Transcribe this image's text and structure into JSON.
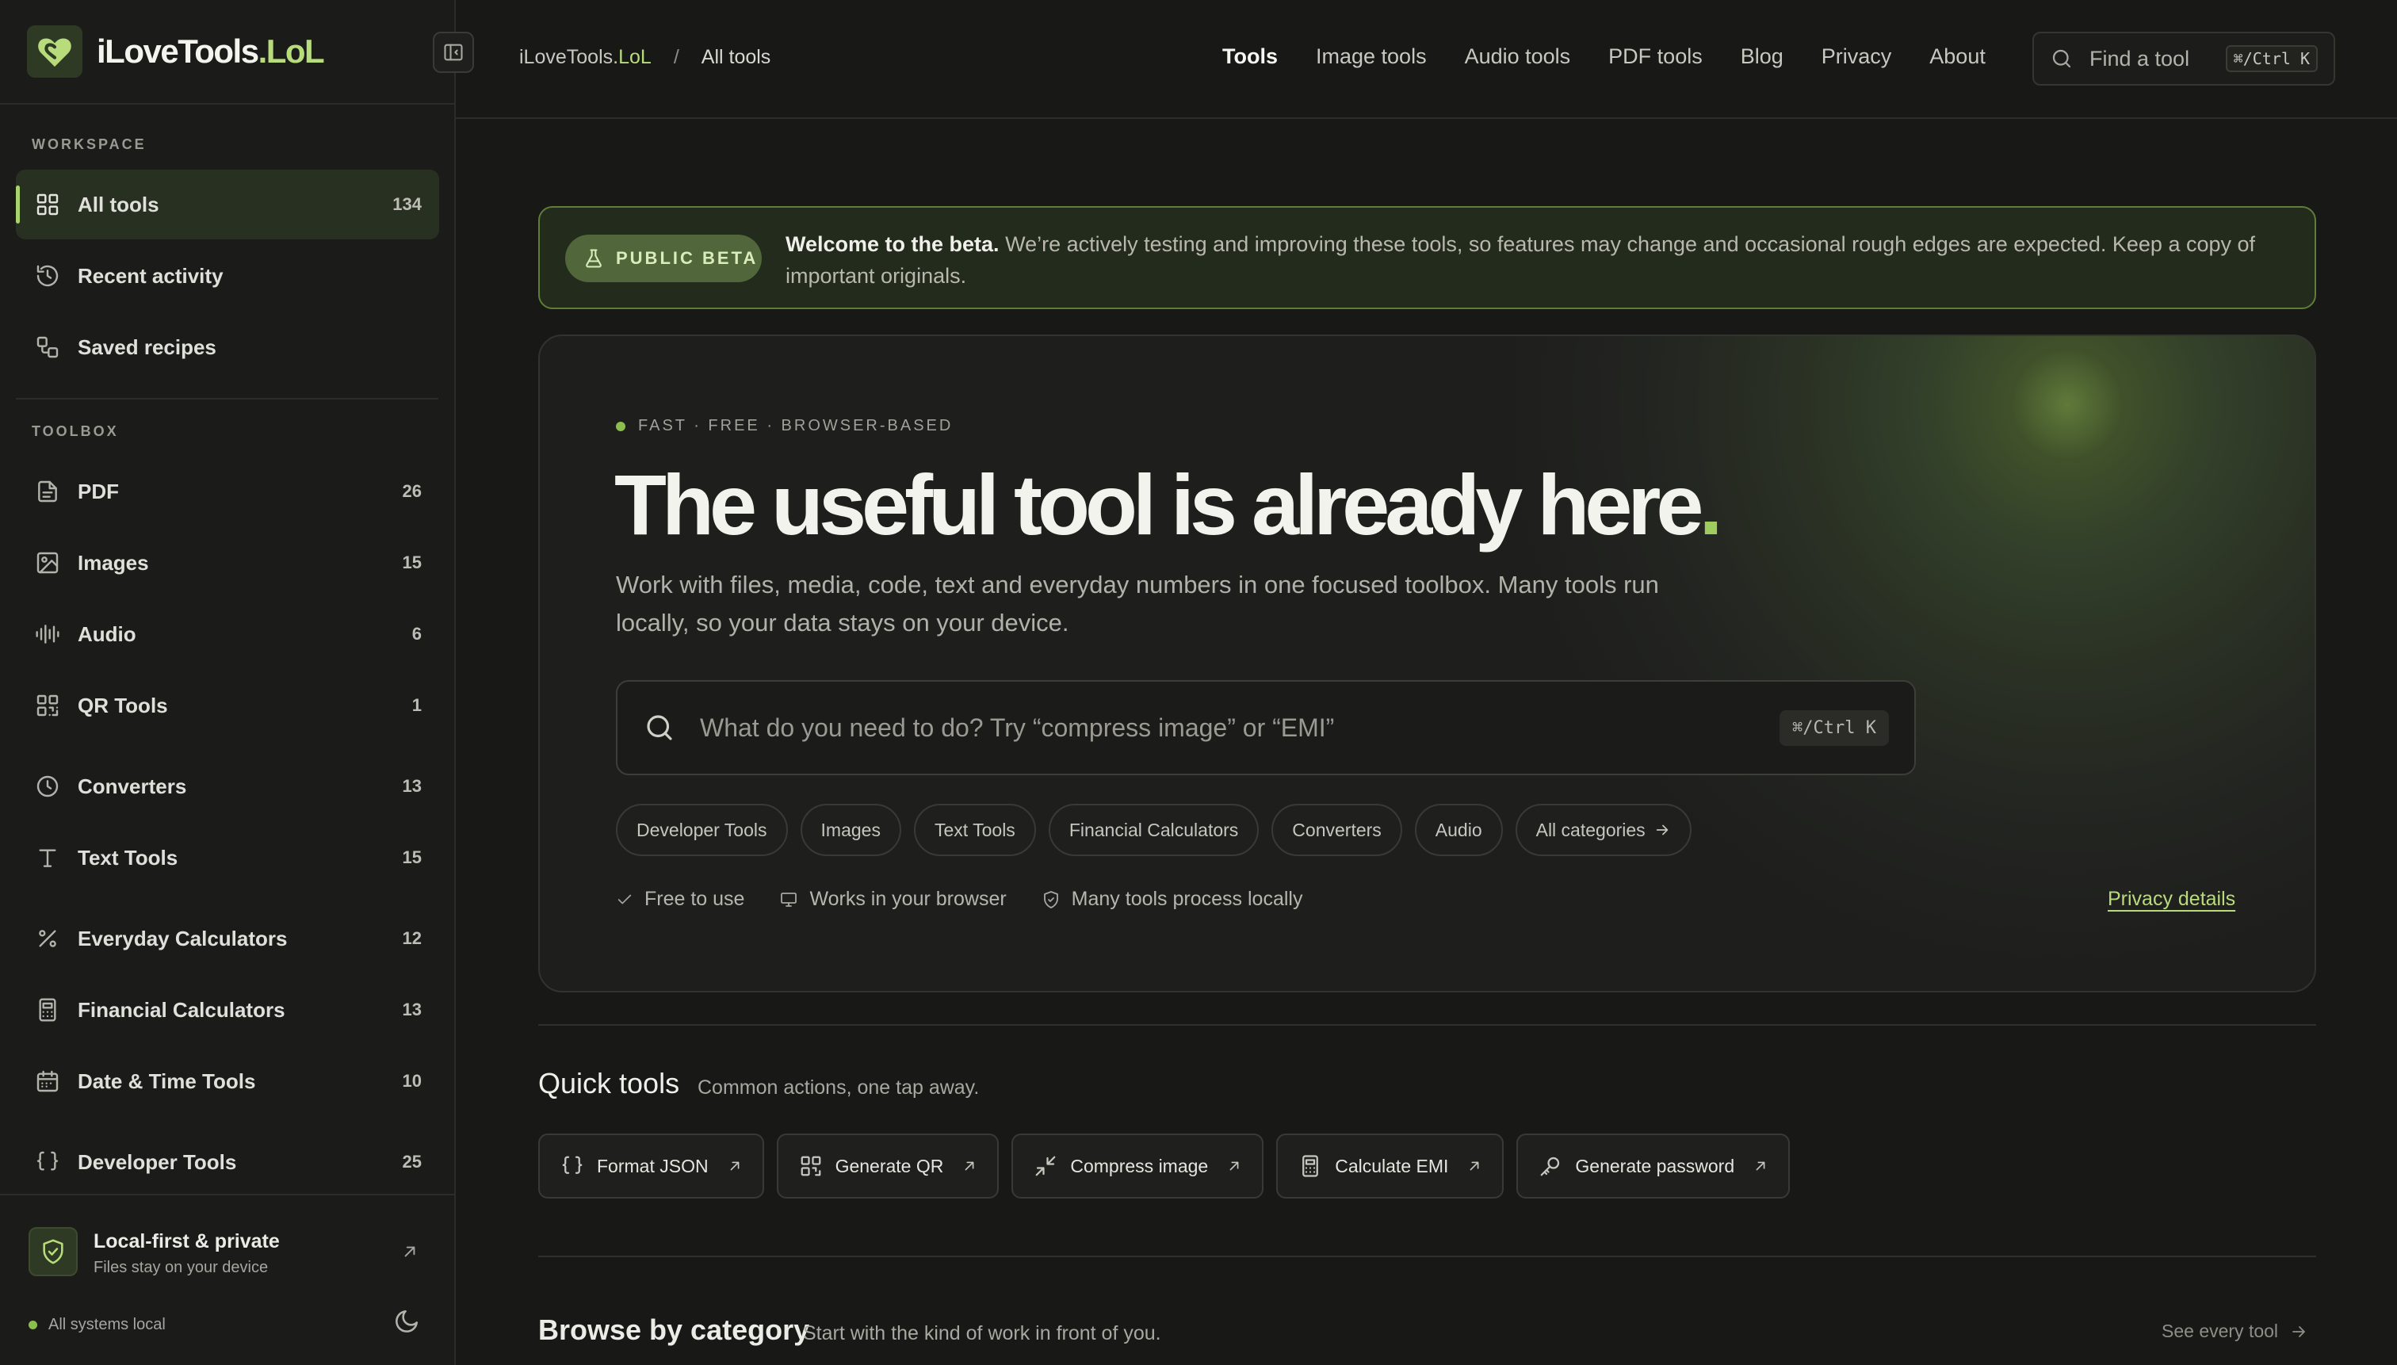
{
  "app": {
    "brand_main": "iLoveTools",
    "brand_accent": ".LoL",
    "accent_color": "#b8dc7c"
  },
  "sidebar": {
    "workspace_label": "WORKSPACE",
    "toolbox_label": "TOOLBOX",
    "workspace": [
      {
        "label": "All tools",
        "count": "134",
        "icon": "grid-icon",
        "active": true
      },
      {
        "label": "Recent activity",
        "icon": "history-icon"
      },
      {
        "label": "Saved recipes",
        "icon": "recipes-icon"
      }
    ],
    "toolbox": [
      {
        "label": "PDF",
        "count": "26",
        "icon": "file-icon"
      },
      {
        "label": "Images",
        "count": "15",
        "icon": "image-icon"
      },
      {
        "label": "Audio",
        "count": "6",
        "icon": "audio-wave-icon"
      },
      {
        "label": "QR Tools",
        "count": "1",
        "icon": "qr-icon"
      },
      {
        "label": "Converters",
        "count": "13",
        "icon": "clock-icon"
      },
      {
        "label": "Text Tools",
        "count": "15",
        "icon": "text-icon"
      },
      {
        "label": "Everyday Calculators",
        "count": "12",
        "icon": "percent-icon"
      },
      {
        "label": "Financial Calculators",
        "count": "13",
        "icon": "calculator-icon"
      },
      {
        "label": "Date & Time Tools",
        "count": "10",
        "icon": "calendar-icon"
      },
      {
        "label": "Developer Tools",
        "count": "25",
        "icon": "braces-icon"
      }
    ],
    "footer": {
      "title": "Local-first & private",
      "subtitle": "Files stay on your device",
      "status": "All systems local"
    }
  },
  "topbar": {
    "breadcrumb_home_main": "iLoveTools",
    "breadcrumb_home_accent": ".LoL",
    "breadcrumb_sep": "/",
    "breadcrumb_current": "All tools",
    "nav": [
      {
        "label": "Tools",
        "active": true
      },
      {
        "label": "Image tools"
      },
      {
        "label": "Audio tools"
      },
      {
        "label": "PDF tools"
      },
      {
        "label": "Blog"
      },
      {
        "label": "Privacy"
      },
      {
        "label": "About"
      }
    ],
    "search_placeholder": "Find a tool",
    "search_shortcut": "⌘/Ctrl K"
  },
  "beta": {
    "badge": "PUBLIC BETA",
    "title": "Welcome to the beta.",
    "text": "We’re actively testing and improving these tools, so features may change and occasional rough edges are expected. Keep a copy of important originals."
  },
  "hero": {
    "kicker": "FAST · FREE · BROWSER-BASED",
    "title": "The useful tool is already here",
    "title_dot": ".",
    "description": "Work with files, media, code, text and everyday numbers in one focused toolbox. Many tools run locally, so your data stays on your device.",
    "search_placeholder": "What do you need to do? Try “compress image” or “EMI”",
    "search_shortcut": "⌘/Ctrl K",
    "chips": [
      "Developer Tools",
      "Images",
      "Text Tools",
      "Financial Calculators",
      "Converters",
      "Audio",
      "All categories"
    ],
    "features": [
      "Free to use",
      "Works in your browser",
      "Many tools process locally"
    ],
    "privacy_link": "Privacy details"
  },
  "quick_tools": {
    "title": "Quick tools",
    "subtitle": "Common actions, one tap away.",
    "items": [
      {
        "label": "Format JSON",
        "icon": "braces-icon"
      },
      {
        "label": "Generate QR",
        "icon": "qr-icon"
      },
      {
        "label": "Compress image",
        "icon": "compress-icon"
      },
      {
        "label": "Calculate EMI",
        "icon": "calculator-icon"
      },
      {
        "label": "Generate password",
        "icon": "key-icon"
      }
    ]
  },
  "browse": {
    "title": "Browse by category",
    "subtitle": "Start with the kind of work in front of you.",
    "see_all": "See every tool"
  }
}
